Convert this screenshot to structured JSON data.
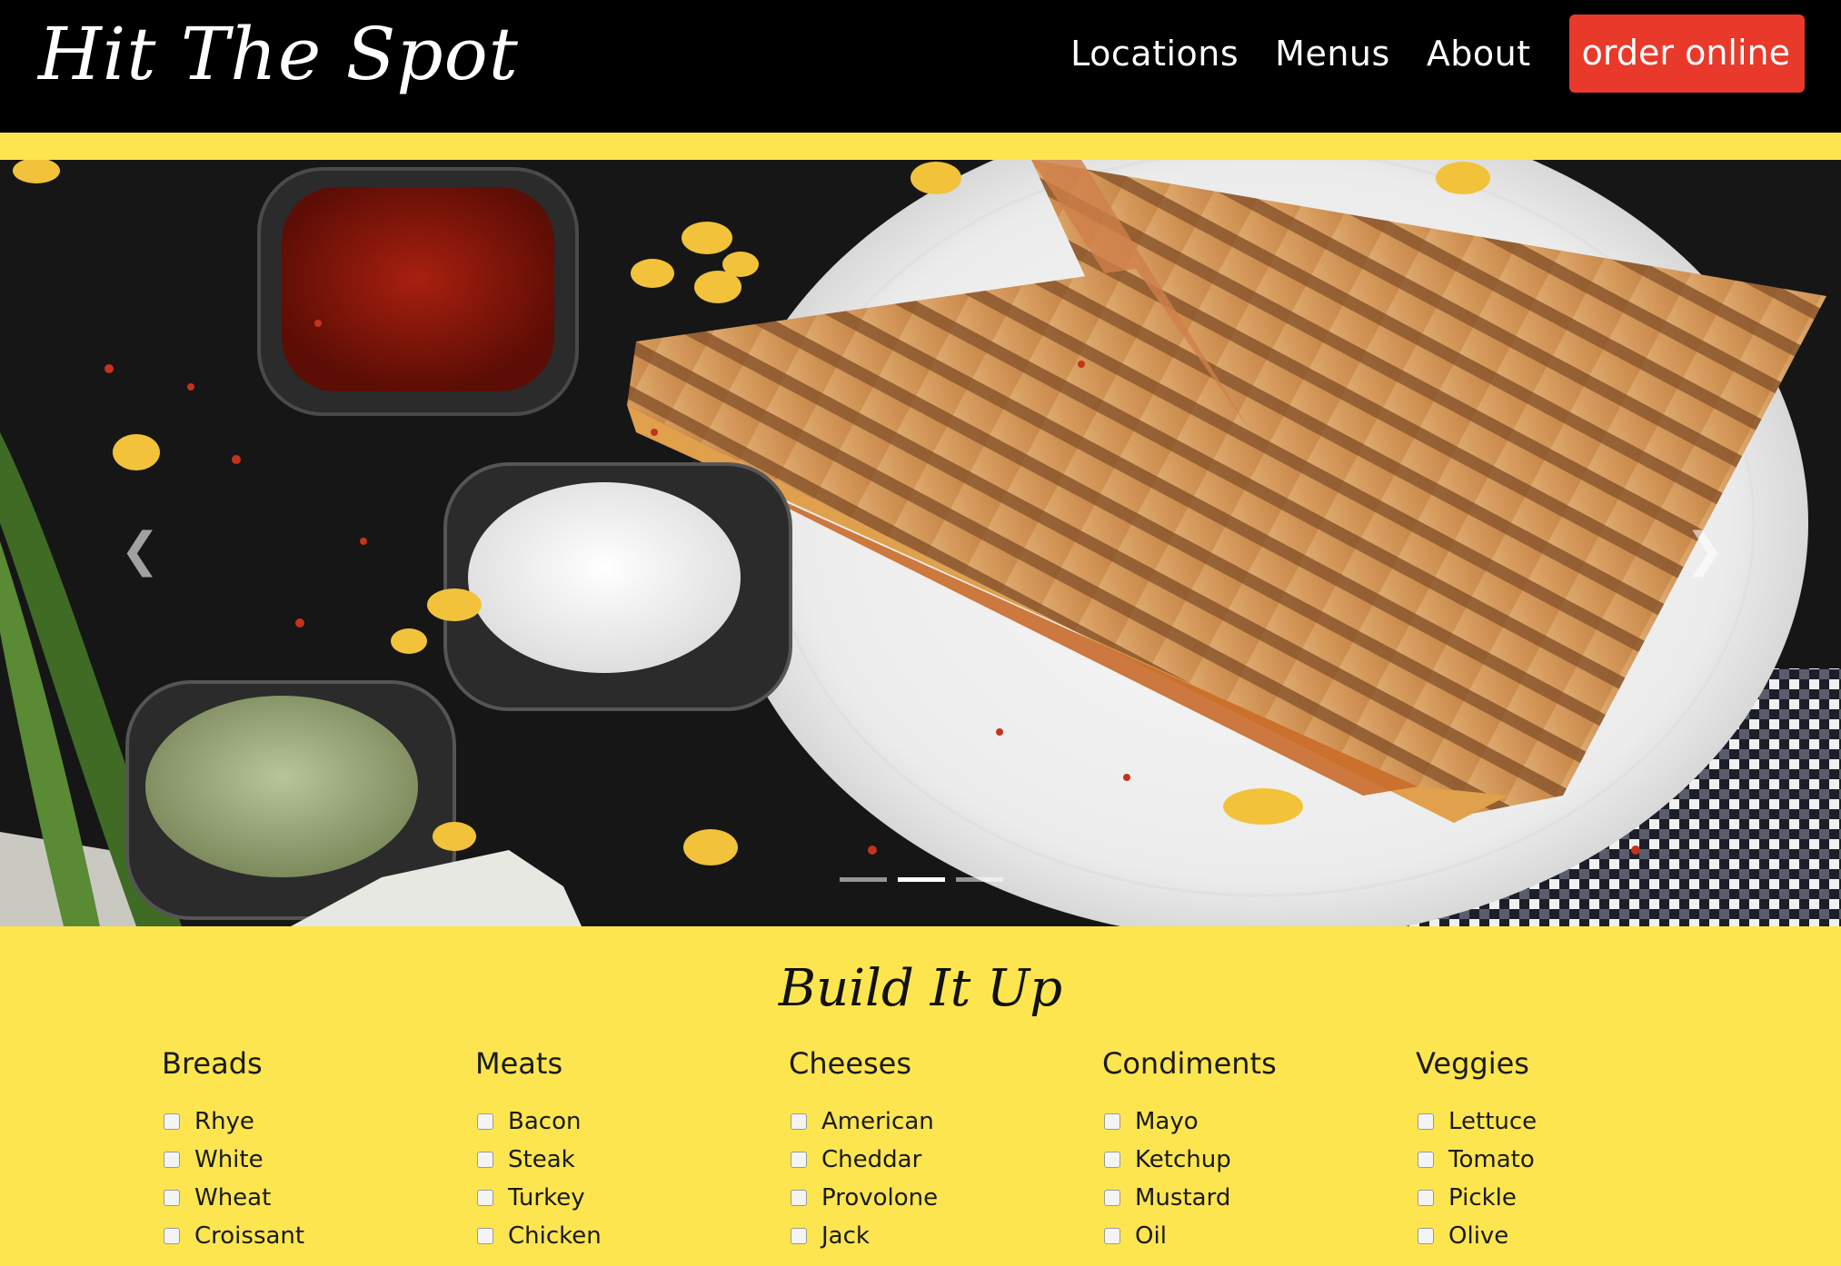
{
  "brand": "Hit The Spot",
  "nav": {
    "links": [
      "Locations",
      "Menus",
      "About"
    ],
    "cta": "order online"
  },
  "colors": {
    "navbar_bg": "#000000",
    "accent_yellow": "#fce54f",
    "cta_red": "#e8392b"
  },
  "carousel": {
    "prev_icon": "chevron-left",
    "next_icon": "chevron-right",
    "slide_count": 3,
    "active_slide": 2
  },
  "builder": {
    "title": "Build It Up",
    "categories": [
      {
        "heading": "Breads",
        "options": [
          "Rhye",
          "White",
          "Wheat",
          "Croissant"
        ]
      },
      {
        "heading": "Meats",
        "options": [
          "Bacon",
          "Steak",
          "Turkey",
          "Chicken"
        ]
      },
      {
        "heading": "Cheeses",
        "options": [
          "American",
          "Cheddar",
          "Provolone",
          "Jack"
        ]
      },
      {
        "heading": "Condiments",
        "options": [
          "Mayo",
          "Ketchup",
          "Mustard",
          "Oil"
        ]
      },
      {
        "heading": "Veggies",
        "options": [
          "Lettuce",
          "Tomato",
          "Pickle",
          "Olive"
        ]
      }
    ]
  }
}
